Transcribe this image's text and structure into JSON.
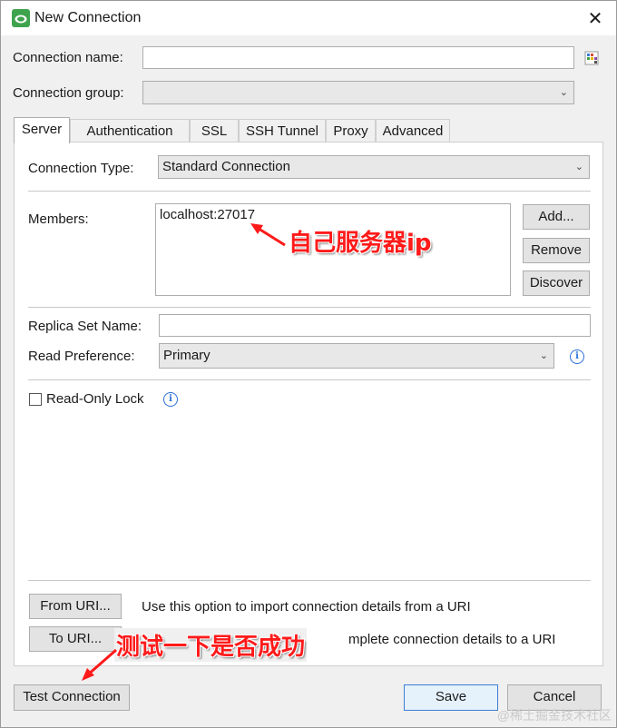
{
  "window": {
    "title": "New Connection"
  },
  "form": {
    "connection_name_label": "Connection name:",
    "connection_name_value": "",
    "connection_group_label": "Connection group:",
    "connection_group_value": ""
  },
  "tabs": [
    {
      "label": "Server",
      "active": true
    },
    {
      "label": "Authentication",
      "active": false
    },
    {
      "label": "SSL",
      "active": false
    },
    {
      "label": "SSH Tunnel",
      "active": false
    },
    {
      "label": "Proxy",
      "active": false
    },
    {
      "label": "Advanced",
      "active": false
    }
  ],
  "server": {
    "connection_type_label": "Connection Type:",
    "connection_type_value": "Standard Connection",
    "members_label": "Members:",
    "members": [
      "localhost:27017"
    ],
    "add_button": "Add...",
    "remove_button": "Remove",
    "discover_button": "Discover",
    "replica_set_label": "Replica Set Name:",
    "replica_set_value": "",
    "read_pref_label": "Read Preference:",
    "read_pref_value": "Primary",
    "readonly_label": "Read-Only Lock",
    "from_uri_button": "From URI...",
    "from_uri_desc": "Use this option to import connection details from a URI",
    "to_uri_button": "To URI...",
    "to_uri_desc_visible": "mplete connection details to a URI"
  },
  "footer": {
    "test_button": "Test Connection",
    "save_button": "Save",
    "cancel_button": "Cancel"
  },
  "annotations": {
    "members_note": "自己服务器ip",
    "test_note": "测试一下是否成功",
    "watermark": "@稀土掘金技术社区"
  },
  "colors": {
    "annotation": "#ff1a1a",
    "accent": "#3c7fd4",
    "app_icon": "#3fa34d"
  }
}
